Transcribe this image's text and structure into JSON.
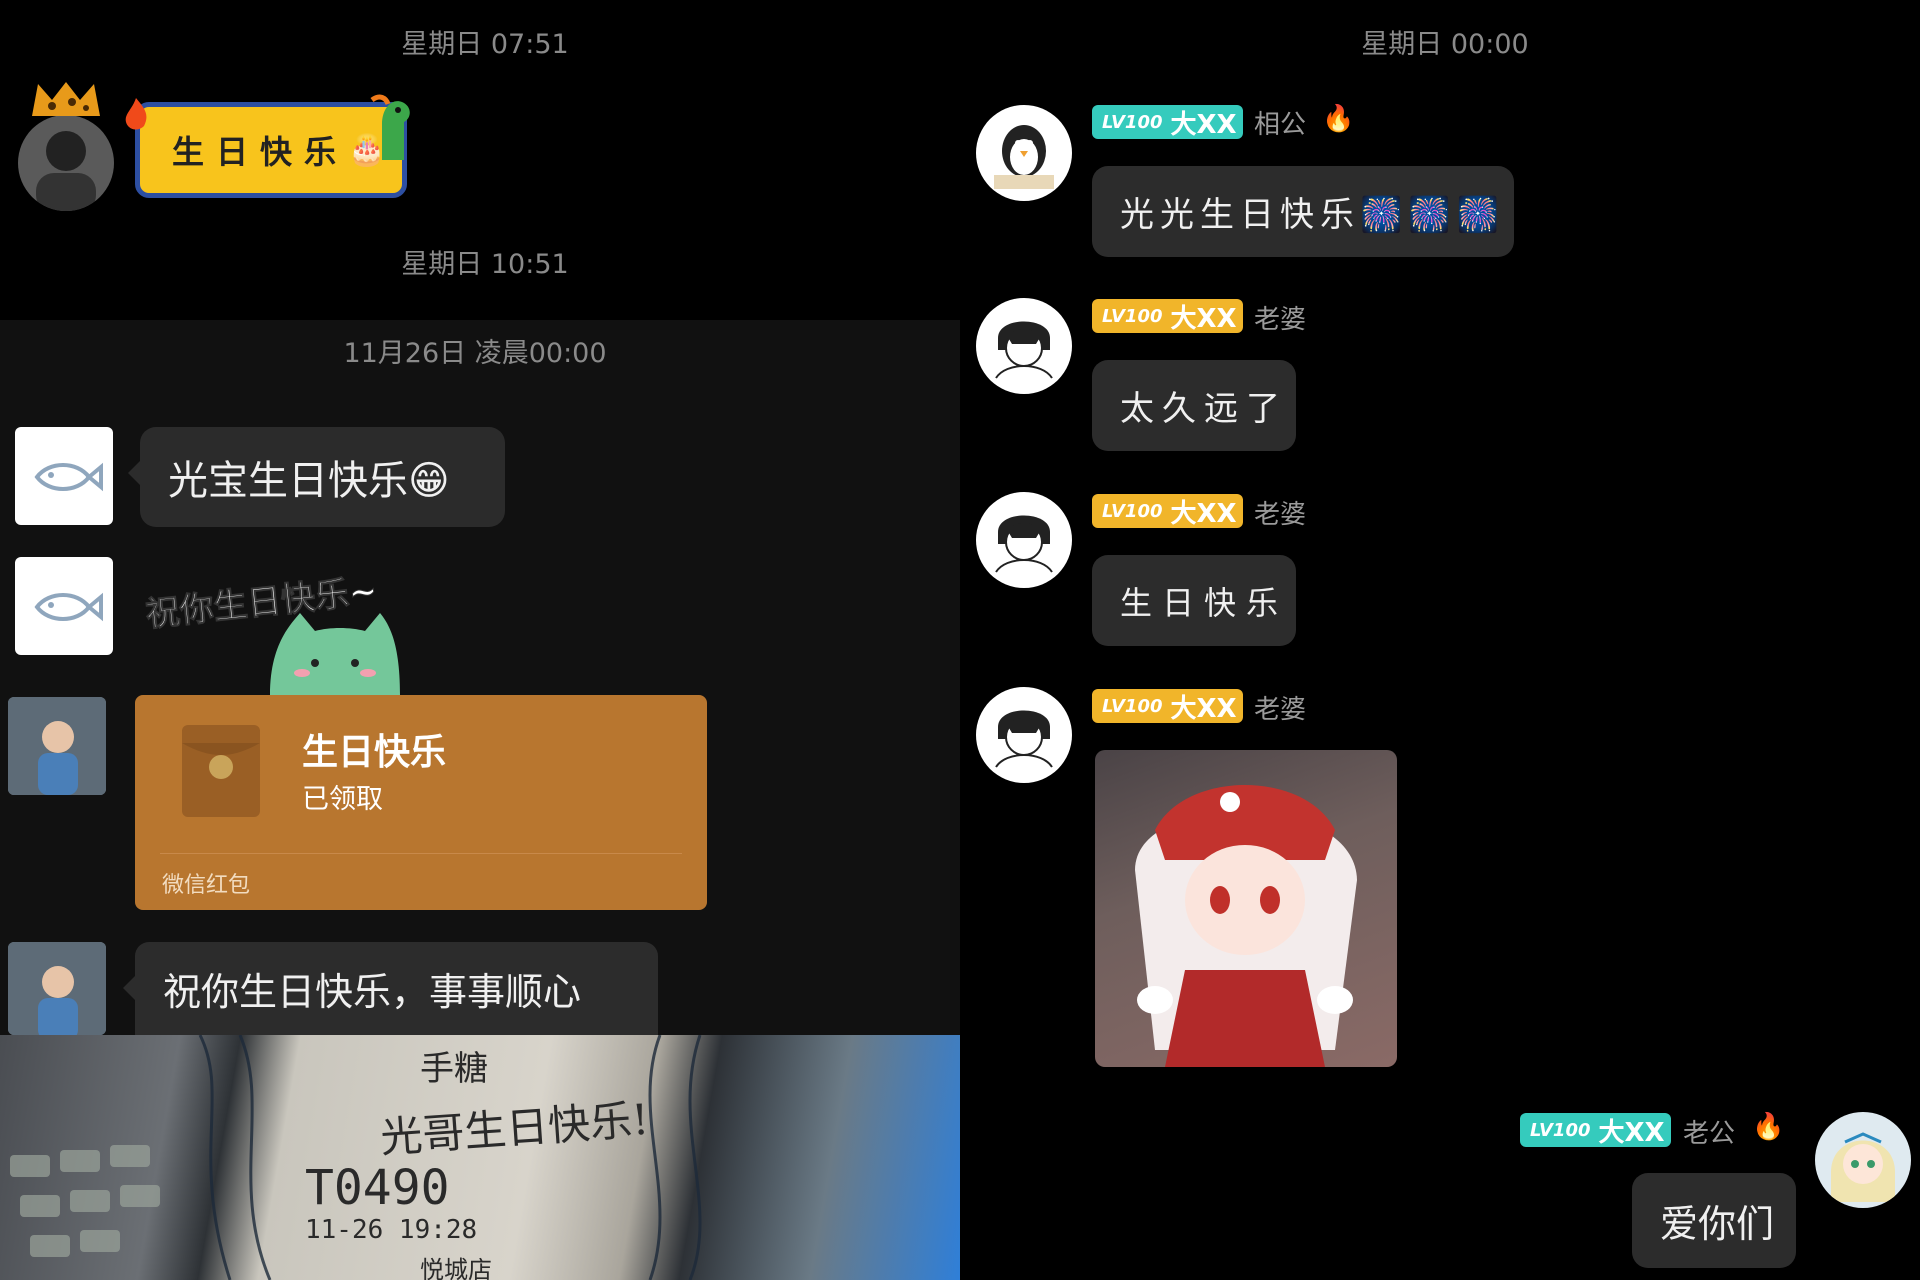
{
  "left": {
    "time1": "星期日 07:51",
    "sticker1_text": "生日快乐",
    "time2": "星期日 10:51",
    "time3": "11月26日 凌晨00:00",
    "msg1": "光宝生日快乐😁",
    "sticker2_text": "祝你生日快乐~",
    "redpacket": {
      "title": "生日快乐",
      "status": "已领取",
      "footer": "微信红包",
      "color": "#b8762f"
    },
    "msg2": "祝你生日快乐，事事顺心",
    "photo_lines": [
      "手糖",
      "光哥生日快乐!",
      "T0490",
      "11-26 19:28",
      "悦城店"
    ]
  },
  "right": {
    "time": "星期日 00:00",
    "messages": [
      {
        "badge_level": "LV100",
        "badge_text": "大XX",
        "badge_color": "#35cbbd",
        "name": "相公",
        "text": "光光生日快乐🎆🎆🎆"
      },
      {
        "badge_level": "LV100",
        "badge_text": "大XX",
        "badge_color": "#f1b52a",
        "name": "老婆",
        "text": "太久远了"
      },
      {
        "badge_level": "LV100",
        "badge_text": "大XX",
        "badge_color": "#f1b52a",
        "name": "老婆",
        "text": "生日快乐"
      },
      {
        "badge_level": "LV100",
        "badge_text": "大XX",
        "badge_color": "#f1b52a",
        "name": "老婆"
      },
      {
        "badge_level": "LV100",
        "badge_text": "大XX",
        "badge_color": "#35cbbd",
        "name": "老公",
        "text": "爱你们"
      }
    ]
  }
}
